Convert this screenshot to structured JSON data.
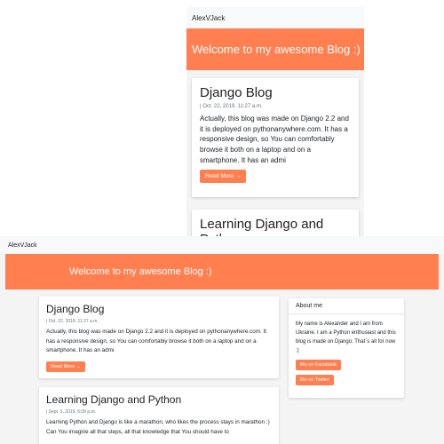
{
  "brand": "AlexVJack",
  "hero_title": "Welcome to my awesome Blog :)",
  "read_more_label": "Read More →",
  "posts": [
    {
      "title": "Django Blog",
      "date": "| Oct. 22, 2019, 11:27 a.m.",
      "excerpt_mobile": "Actually, this blog was made on Django 2.2 and it is deployed on pythonanywhere.com. It has a responsive design, so You can comfortably browse it both on a laptop and on a smartphone. It has an admi",
      "excerpt_desktop": "Actually, this blog was made on Django 2.2 and it is deployed on pythonanywhere.com. It has a responsive design, so You can comfortably browse it both on a laptop and on a smartphone. It has an admi"
    },
    {
      "title": "Learning Django and Python",
      "date": "| Sept. 5, 2019, 6:09 p.m.",
      "excerpt_desktop": "Learning Python and Django is like a marathon, who likes the process stays in marathon :) Can You imagine all that steps, all that knowledge that You should have to"
    }
  ],
  "sidebar": {
    "title": "About me",
    "text": "My name is Alexander and I am from Ukraine. I am a Python enthusiast and this blog is made on Django. That`s all for now :)",
    "facebook_label": "Me on Facebook",
    "twitter_label": "Me on Twitter"
  },
  "colors": {
    "accent": "#ff7f50",
    "navbar": "#f8f9fa",
    "background": "#f4f4f4"
  }
}
